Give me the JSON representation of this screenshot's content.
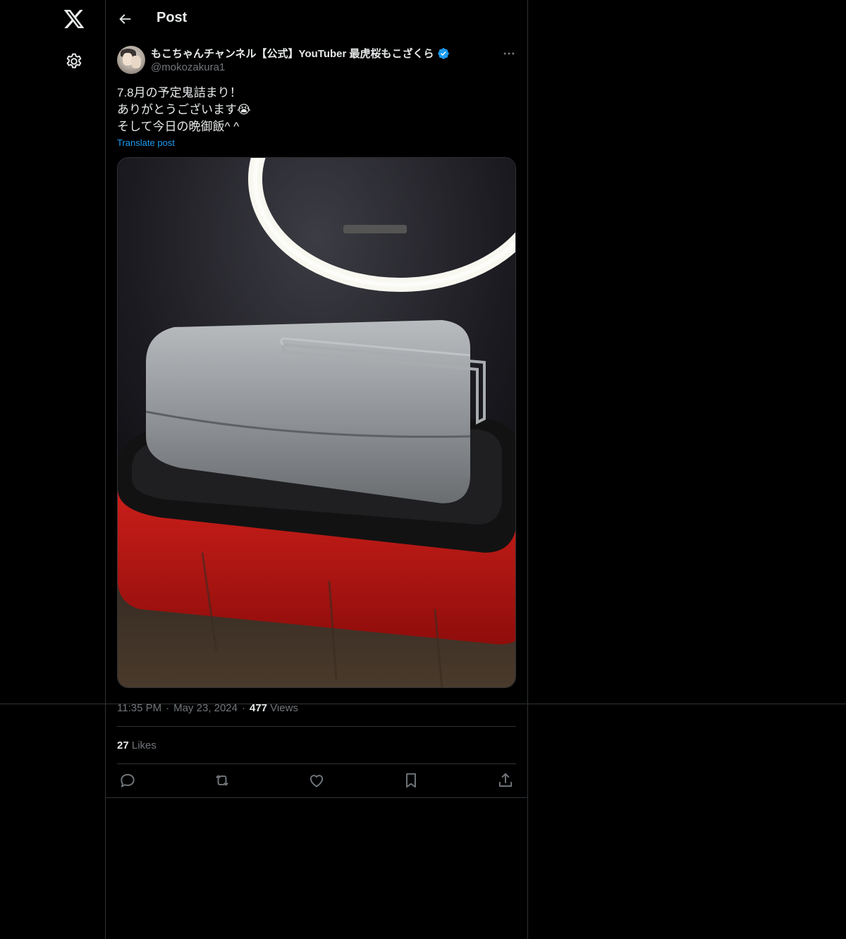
{
  "header": {
    "title": "Post"
  },
  "author": {
    "display_name": "もこちゃんチャンネル【公式】YouTuber 最虎桜もこざくら",
    "handle": "@mokozakura1",
    "verified": true
  },
  "tweet": {
    "text": "7.8月の予定鬼詰まり！\nありがとうございます😭\nそして今日の晩御飯^ ^",
    "translate_label": "Translate post",
    "media_alt": "Aluminum mess tin on a black and red grill plate under a ring light"
  },
  "meta": {
    "time": "11:35 PM",
    "date": "May 23, 2024",
    "views_count": "477",
    "views_label": "Views"
  },
  "stats": {
    "likes_count": "27",
    "likes_label": "Likes"
  },
  "icons": {
    "logo": "x-logo-icon",
    "settings": "gear-icon",
    "back": "arrow-left-icon",
    "more": "more-horizontal-icon",
    "reply": "reply-icon",
    "repost": "repost-icon",
    "like": "heart-icon",
    "bookmark": "bookmark-icon",
    "share": "share-icon"
  },
  "colors": {
    "background": "#000000",
    "accent": "#1d9bf0",
    "border": "#2f3336",
    "muted": "#71767b",
    "text": "#e7e9ea"
  }
}
